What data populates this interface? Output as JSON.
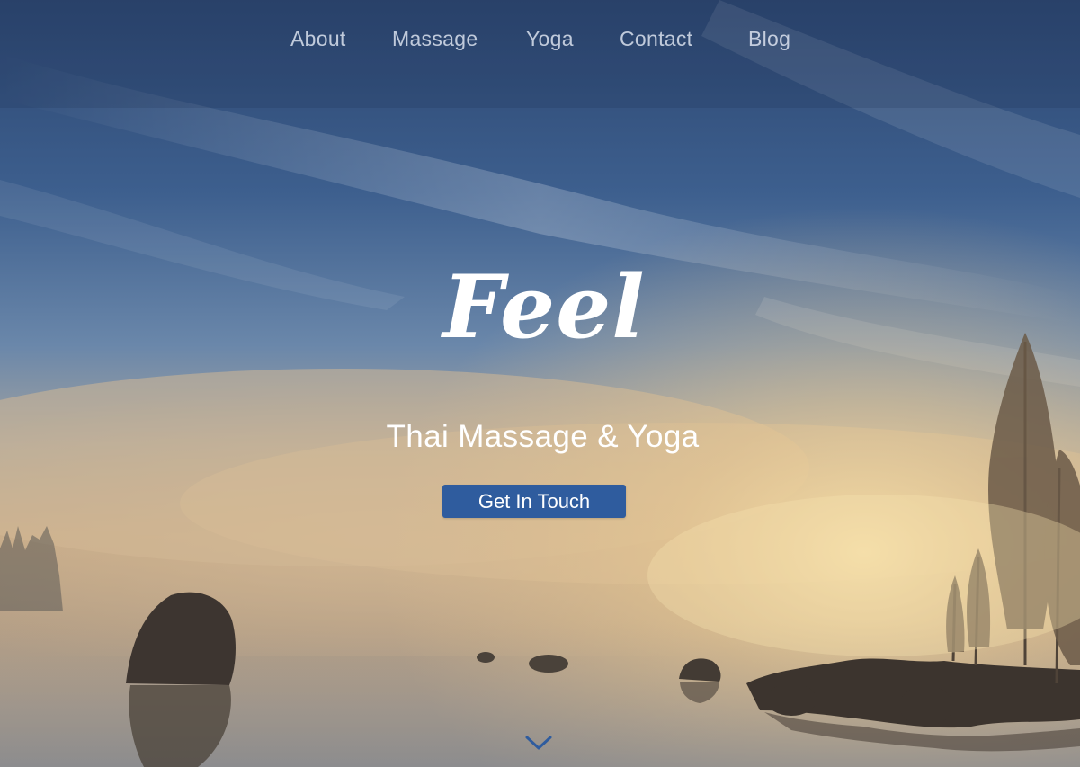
{
  "nav": {
    "items": [
      {
        "label": "About"
      },
      {
        "label": "Massage"
      },
      {
        "label": "Yoga"
      },
      {
        "label": "Contact"
      },
      {
        "label": "Blog"
      }
    ]
  },
  "hero": {
    "logo_text": "Feel",
    "tagline": "Thai Massage & Yoga",
    "cta_label": "Get In Touch",
    "scroll_icon": "chevron-down-icon"
  },
  "colors": {
    "accent": "#2f5c9e",
    "sky_top": "#2f4a75",
    "sky_mid": "#5476a3",
    "mist": "#c9ad8a",
    "sun": "#f2d7a0",
    "nav_text": "#ebf0fa"
  }
}
